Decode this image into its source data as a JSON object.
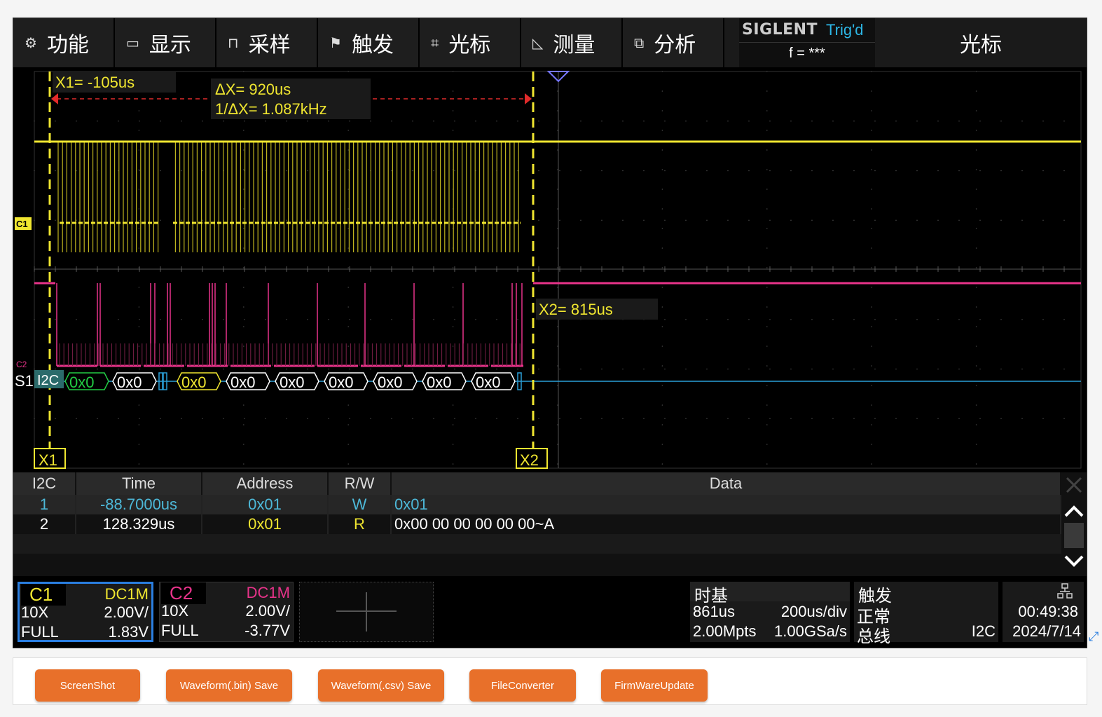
{
  "menu": {
    "items": [
      {
        "label": "功能",
        "icon": "gear-icon",
        "glyph": "⚙"
      },
      {
        "label": "显示",
        "icon": "monitor-icon",
        "glyph": "🖵"
      },
      {
        "label": "采样",
        "icon": "sample-icon",
        "glyph": "⊓"
      },
      {
        "label": "触发",
        "icon": "flag-icon",
        "glyph": "⚑"
      },
      {
        "label": "光标",
        "icon": "cursor-grid-icon",
        "glyph": "⌗"
      },
      {
        "label": "测量",
        "icon": "ruler-icon",
        "glyph": "◺"
      },
      {
        "label": "分析",
        "icon": "analysis-icon",
        "glyph": "⧉"
      }
    ],
    "brand": "SIGLENT",
    "trigger_status": "Trig'd",
    "frequency": "f = ***",
    "panel_title": "光标"
  },
  "cursors": {
    "x1_label": "X1= -105us",
    "delta_x": "ΔX= 920us",
    "inv_delta_x": "1/ΔX= 1.087kHz",
    "x2_label": "X2= 815us",
    "x1_marker": "X1",
    "x2_marker": "X2"
  },
  "channels": {
    "c1_tag": "C1",
    "c2_tag": "C2",
    "bus_tag": "S1",
    "bus_protocol": "I2C",
    "bus_frames": [
      "0x0",
      "0x0",
      "0x0",
      "0x0",
      "0x0",
      "0x0",
      "0x0",
      "0x0",
      "0x0"
    ]
  },
  "decode_table": {
    "headers": [
      "I2C",
      "Time",
      "Address",
      "R/W",
      "Data"
    ],
    "rows": [
      {
        "index": "1",
        "time": "-88.7000us",
        "address": "0x01",
        "rw": "W",
        "data": "0x01"
      },
      {
        "index": "2",
        "time": "128.329us",
        "address": "0x01",
        "rw": "R",
        "data": "0x00 00 00 00 00 00~A"
      }
    ]
  },
  "status": {
    "c1": {
      "name": "C1",
      "coupling": "DC1M",
      "probe": "10X",
      "scale": "2.00V/",
      "bw": "FULL",
      "offset": "1.83V"
    },
    "c2": {
      "name": "C2",
      "coupling": "DC1M",
      "probe": "10X",
      "scale": "2.00V/",
      "bw": "FULL",
      "offset": "-3.77V"
    },
    "timebase": {
      "title": "时基",
      "delay": "861us",
      "scale": "200us/div",
      "memory": "2.00Mpts",
      "rate": "1.00GSa/s"
    },
    "trigger": {
      "title": "触发",
      "mode": "正常",
      "type": "总线",
      "source": "I2C"
    },
    "clock": {
      "time": "00:49:38",
      "date": "2024/7/14"
    }
  },
  "buttons": [
    "ScreenShot",
    "Waveform(.bin) Save",
    "Waveform(.csv) Save",
    "FileConverter",
    "FirmWareUpdate"
  ],
  "colors": {
    "c1": "#f0e630",
    "c2": "#e8338a",
    "bus": "#2a9fd8",
    "accent": "#e8702a"
  }
}
